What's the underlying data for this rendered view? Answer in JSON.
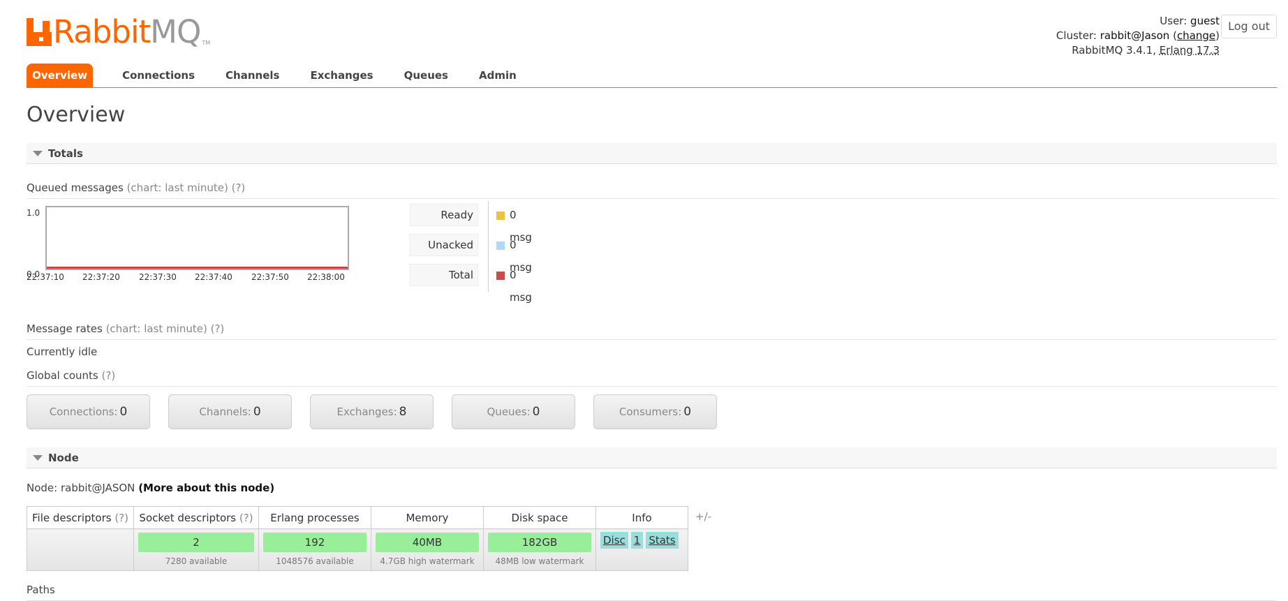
{
  "logo": {
    "rabbit": "Rabbit",
    "mq": "MQ",
    "tm": "TM"
  },
  "header": {
    "user_label": "User:",
    "user": "guest",
    "cluster_label": "Cluster:",
    "cluster": "rabbit@Jason",
    "change_link": "change",
    "version": "RabbitMQ 3.4.1,",
    "erlang": "Erlang 17.3",
    "logout": "Log out"
  },
  "tabs": [
    "Overview",
    "Connections",
    "Channels",
    "Exchanges",
    "Queues",
    "Admin"
  ],
  "page_title": "Overview",
  "sections": {
    "totals": "Totals",
    "node": "Node"
  },
  "queued": {
    "title": "Queued messages",
    "chart_note": "(chart: last minute)",
    "help": "(?)"
  },
  "chart_data": {
    "type": "line",
    "ylim": [
      0,
      1.0
    ],
    "yticks": [
      "1.0",
      "0.0"
    ],
    "x": [
      "22:37:10",
      "22:37:20",
      "22:37:30",
      "22:37:40",
      "22:37:50",
      "22:38:00"
    ],
    "series": [
      {
        "name": "Ready",
        "values": [
          0,
          0,
          0,
          0,
          0,
          0
        ],
        "color": "#edc240"
      },
      {
        "name": "Unacked",
        "values": [
          0,
          0,
          0,
          0,
          0,
          0
        ],
        "color": "#afd8f8"
      },
      {
        "name": "Total",
        "values": [
          0,
          0,
          0,
          0,
          0,
          0
        ],
        "color": "#cb4b4b"
      }
    ]
  },
  "legend": [
    {
      "name": "Ready",
      "amount": "0 msg",
      "color": "#edc240"
    },
    {
      "name": "Unacked",
      "amount": "0 msg",
      "color": "#afd8f8"
    },
    {
      "name": "Total",
      "amount": "0 msg",
      "color": "#cb4b4b"
    }
  ],
  "rates": {
    "title": "Message rates",
    "chart_note": "(chart: last minute)",
    "help": "(?)"
  },
  "idle": "Currently idle",
  "global": {
    "title": "Global counts",
    "help": "(?)"
  },
  "counts": [
    {
      "label": "Connections:",
      "value": "0"
    },
    {
      "label": "Channels:",
      "value": "0"
    },
    {
      "label": "Exchanges:",
      "value": "8"
    },
    {
      "label": "Queues:",
      "value": "0"
    },
    {
      "label": "Consumers:",
      "value": "0"
    }
  ],
  "node": {
    "label": "Node:",
    "name": "rabbit@JASON",
    "more": "(More about this node)",
    "headers": [
      "File descriptors",
      "Socket descriptors",
      "Erlang processes",
      "Memory",
      "Disk space",
      "Info"
    ],
    "help": "(?)",
    "socket": {
      "value": "2",
      "sub": "7280 available"
    },
    "erlang": {
      "value": "192",
      "sub": "1048576 available"
    },
    "memory": {
      "value": "40MB",
      "sub": "4.7GB high watermark"
    },
    "disk": {
      "value": "182GB",
      "sub": "48MB low watermark"
    },
    "info": [
      "Disc",
      "1",
      "Stats"
    ],
    "plusminus": "+/-"
  },
  "paths": "Paths"
}
